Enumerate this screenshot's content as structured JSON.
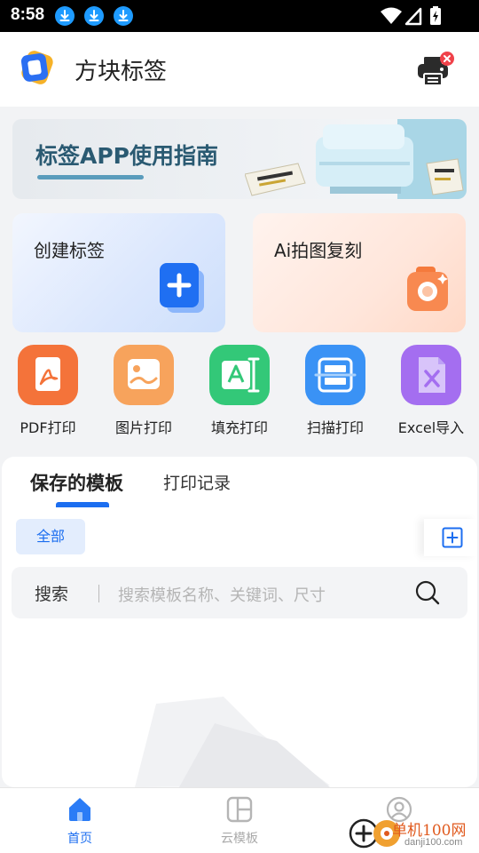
{
  "status_bar": {
    "time": "8:58",
    "notification_icons": [
      "download-icon",
      "download-icon",
      "download-icon"
    ],
    "system_icons": [
      "wifi-icon",
      "signal-icon",
      "battery-charging-icon"
    ]
  },
  "header": {
    "app_title": "方块标签",
    "printer_status": "disconnected"
  },
  "banner": {
    "title": "标签APP使用指南"
  },
  "cards": [
    {
      "label": "创建标签",
      "icon": "add-document-icon"
    },
    {
      "label": "Ai拍图复刻",
      "icon": "camera-icon"
    }
  ],
  "tools": [
    {
      "label": "PDF打印",
      "icon": "pdf-icon",
      "color": "#f4733a"
    },
    {
      "label": "图片打印",
      "icon": "image-icon",
      "color": "#f7a35c"
    },
    {
      "label": "填充打印",
      "icon": "fill-text-icon",
      "color": "#33c878"
    },
    {
      "label": "扫描打印",
      "icon": "scan-icon",
      "color": "#3a92f5"
    },
    {
      "label": "Excel导入",
      "icon": "excel-icon",
      "color": "#a46ef0"
    }
  ],
  "panel": {
    "tabs": [
      {
        "label": "保存的模板",
        "active": true
      },
      {
        "label": "打印记录",
        "active": false
      }
    ],
    "filter_chip": "全部",
    "search": {
      "label": "搜索",
      "placeholder": "搜索模板名称、关键词、尺寸"
    }
  },
  "bottom_nav": [
    {
      "label": "首页",
      "icon": "home-icon",
      "active": true
    },
    {
      "label": "云模板",
      "icon": "template-grid-icon",
      "active": false
    },
    {
      "label": "",
      "icon": "profile-icon",
      "active": false
    }
  ],
  "watermark": {
    "brand": "单机100网",
    "domain": "danji100.com"
  },
  "colors": {
    "accent": "#1c6ef0",
    "banner_title": "#2a5a72"
  }
}
